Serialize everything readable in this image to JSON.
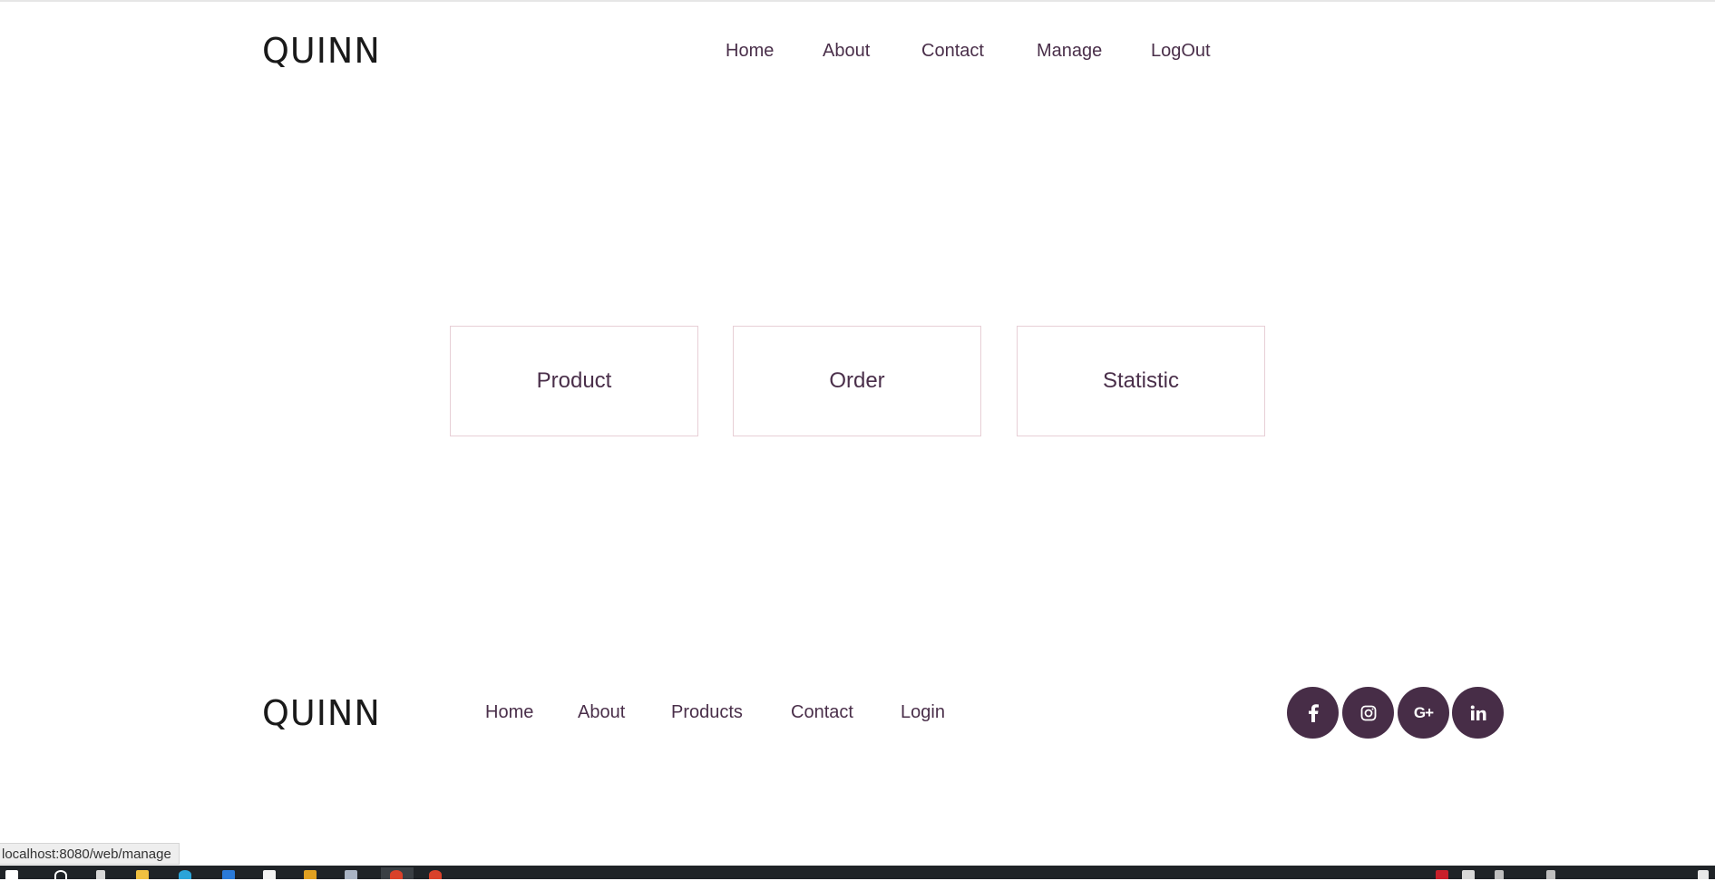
{
  "header": {
    "logo": "QUINN",
    "nav": [
      "Home",
      "About",
      "Contact",
      "Manage",
      "LogOut"
    ]
  },
  "cards": [
    "Product",
    "Order",
    "Statistic"
  ],
  "footer": {
    "logo": "QUINN",
    "links": [
      "Home",
      "About",
      "Products",
      "Contact",
      "Login"
    ],
    "social": [
      {
        "icon": "facebook-icon"
      },
      {
        "icon": "instagram-icon"
      },
      {
        "icon": "google-plus-icon",
        "label": "G+"
      },
      {
        "icon": "linkedin-icon"
      }
    ]
  },
  "status_bar": {
    "url": "localhost:8080/web/manage"
  },
  "colors": {
    "text": "#4a2f4a",
    "accent": "#472d47",
    "card_border": "#e7cfd6"
  }
}
